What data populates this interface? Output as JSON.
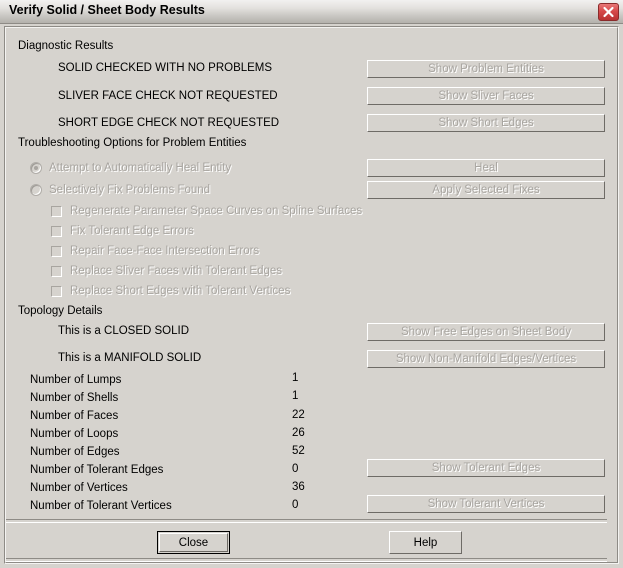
{
  "window": {
    "title": "Verify Solid / Sheet Body Results",
    "close_icon": "close-icon",
    "accent_close": "#d64a4a",
    "face_color": "#d6d3ce"
  },
  "diagnostic": {
    "group_label": "Diagnostic Results",
    "rows": [
      {
        "text": "SOLID CHECKED WITH NO PROBLEMS",
        "button": "Show Problem Entities",
        "enabled": false
      },
      {
        "text": "SLIVER FACE CHECK NOT REQUESTED",
        "button": "Show Sliver Faces",
        "enabled": false
      },
      {
        "text": "SHORT EDGE CHECK NOT REQUESTED",
        "button": "Show Short Edges",
        "enabled": false
      }
    ]
  },
  "troubleshooting": {
    "group_label": "Troubleshooting Options for Problem Entities",
    "radios": [
      {
        "label": "Attempt to Automatically Heal Entity",
        "selected": true,
        "enabled": false,
        "button": "Heal"
      },
      {
        "label": "Selectively Fix Problems Found",
        "selected": false,
        "enabled": false,
        "button": "Apply Selected Fixes"
      }
    ],
    "checkboxes": [
      {
        "label": "Regenerate Parameter Space Curves on Spline Surfaces",
        "checked": false,
        "enabled": false
      },
      {
        "label": "Fix Tolerant Edge Errors",
        "checked": false,
        "enabled": false
      },
      {
        "label": "Repair Face-Face Intersection Errors",
        "checked": false,
        "enabled": false
      },
      {
        "label": "Replace Sliver Faces with Tolerant Edges",
        "checked": false,
        "enabled": false
      },
      {
        "label": "Replace Short Edges with Tolerant Vertices",
        "checked": false,
        "enabled": false
      }
    ]
  },
  "topology": {
    "group_label": "Topology Details",
    "statements": [
      {
        "text": "This is a CLOSED SOLID",
        "button": "Show Free Edges on Sheet Body",
        "enabled": false
      },
      {
        "text": "This is a MANIFOLD SOLID",
        "button": "Show Non-Manifold Edges/Vertices",
        "enabled": false
      }
    ],
    "counts": [
      {
        "label": "Number of Lumps",
        "value": "1"
      },
      {
        "label": "Number of Shells",
        "value": "1"
      },
      {
        "label": "Number of Faces",
        "value": "22"
      },
      {
        "label": "Number of Loops",
        "value": "26"
      },
      {
        "label": "Number of Edges",
        "value": "52"
      },
      {
        "label": "Number of Tolerant Edges",
        "value": "0"
      },
      {
        "label": "Number of Vertices",
        "value": "36"
      },
      {
        "label": "Number of Tolerant Vertices",
        "value": "0"
      }
    ],
    "tolerant_buttons": [
      {
        "label": "Show Tolerant Edges",
        "enabled": false
      },
      {
        "label": "Show Tolerant Vertices",
        "enabled": false
      }
    ]
  },
  "footer": {
    "close_label": "Close",
    "help_label": "Help"
  }
}
